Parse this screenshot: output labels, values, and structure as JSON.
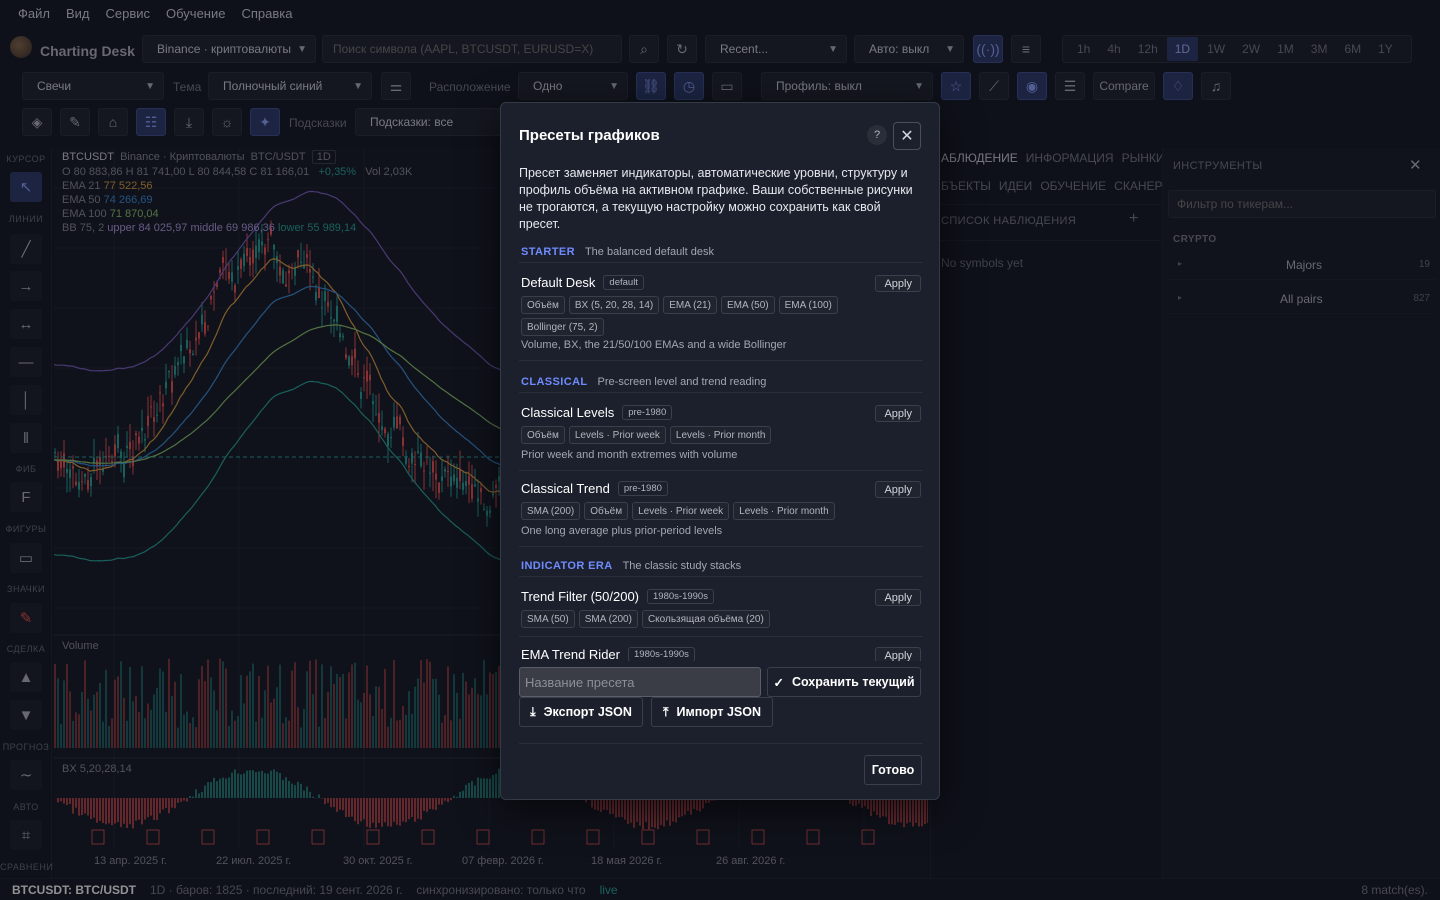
{
  "menu": [
    "Файл",
    "Вид",
    "Сервис",
    "Обучение",
    "Справка"
  ],
  "toolbar1": {
    "app_name": "Charting Desk",
    "exchange": "Binance · криптовалюты",
    "search_placeholder": "Поиск символа (AAPL, BTCUSDT, EURUSD=X)",
    "recent": "Recent...",
    "auto": "Авто: выкл",
    "timeframes": [
      "1h",
      "4h",
      "12h",
      "1D",
      "1W",
      "2W",
      "1M",
      "3M",
      "6M",
      "1Y"
    ],
    "active_timeframe": "1D"
  },
  "toolbar2": {
    "chart_type": "Свечи",
    "theme_label": "Тема",
    "theme": "Полночный синий",
    "layout_label": "Расположение",
    "layout": "Одно",
    "profile": "Профиль: выкл",
    "compare": "Compare"
  },
  "toolbar3": {
    "hints_label": "Подсказки",
    "hints": "Подсказки: все"
  },
  "leftbar": {
    "cursor": "КУРСОР",
    "lines": "ЛИНИИ",
    "fib": "ФИБ",
    "fib_btn": "F",
    "shapes": "ФИГУРЫ",
    "icons": "ЗНАЧКИ",
    "trade": "СДЕЛКА",
    "forecast": "ПРОГНОЗ",
    "auto": "АВТО",
    "compare": "СРАВНЕНИЕ"
  },
  "chart": {
    "symbol": "BTCUSDT",
    "exchange": "Binance · Криптовалюты",
    "pair": "BTC/USDT",
    "tf": "1D",
    "ohlc": "O 80 883,86   H 81 741,00   L 80 844,58   C 81 166,01",
    "change": "+0,35%",
    "vol": "Vol 2,03K",
    "ema21_label": "EMA 21",
    "ema21": "77 522,56",
    "ema50_label": "EMA 50",
    "ema50": "74 266,69",
    "ema100_label": "EMA 100",
    "ema100": "71 870,04",
    "bb_label": "BB 75, 2",
    "bb_upper": "upper 84 025,97",
    "bb_middle": "middle 69 986,36",
    "bb_lower": "lower 55 989,14",
    "volume_label": "Volume",
    "bx_label": "BX 5,20,28,14",
    "dates": [
      "13 апр. 2025 г.",
      "22 июл. 2025 г.",
      "30 окт. 2025 г.",
      "07 февр. 2026 г.",
      "18 мая 2026 г.",
      "26 авг. 2026 г."
    ],
    "colors": {
      "ema21": "#e0a040",
      "ema50": "#3a8fd9",
      "ema100": "#8ec96a",
      "bb_band": "#7b5fc4",
      "bb_lower": "#26a69a",
      "up": "#26a69a",
      "down": "#ef5350"
    }
  },
  "watch": {
    "tabs_row1": [
      "АБЛЮДЕНИЕ",
      "ИНФОРМАЦИЯ",
      "РЫНКИ"
    ],
    "tabs_row2": [
      "БЪЕКТЫ",
      "ИДЕИ",
      "ОБУЧЕНИЕ",
      "СКАНЕР"
    ],
    "list_title": "СПИСОК НАБЛЮДЕНИЯ",
    "empty": "No symbols yet"
  },
  "instruments": {
    "title": "ИНСТРУМЕНТЫ",
    "filter_placeholder": "Фильтр по тикерам...",
    "group": "CRYPTO",
    "rows": [
      {
        "name": "Majors",
        "count": "19"
      },
      {
        "name": "All pairs",
        "count": "827"
      }
    ]
  },
  "status": {
    "symbol": "BTCUSDT: BTC/USDT",
    "info": "1D · баров: 1825 · последний: 19 сент. 2026 г.",
    "sync": "синхронизировано: только что",
    "live": "live",
    "matches": "8 match(es)."
  },
  "modal": {
    "title": "Пресеты графиков",
    "help": "?",
    "description": "Пресет заменяет индикаторы, автоматические уровни, структуру и профиль объёма на активном графике. Ваши собственные рисунки не трогаются, а текущую настройку можно сохранить как свой пресет.",
    "apply_label": "Apply",
    "groups": [
      {
        "key": "STARTER",
        "sub": "The balanced default desk"
      },
      {
        "key": "CLASSICAL",
        "sub": "Pre-screen level and trend reading"
      },
      {
        "key": "INDICATOR ERA",
        "sub": "The classic study stacks"
      }
    ],
    "presets": [
      {
        "name": "Default Desk",
        "era": "default",
        "chips": [
          "Объём",
          "BX (5, 20, 28, 14)",
          "EMA (21)",
          "EMA (50)",
          "EMA (100)",
          "Bollinger (75, 2)"
        ],
        "desc": "Volume, BX, the 21/50/100 EMAs and a wide Bollinger"
      },
      {
        "name": "Classical Levels",
        "era": "pre-1980",
        "chips": [
          "Объём",
          "Levels · Prior week",
          "Levels · Prior month"
        ],
        "desc": "Prior week and month extremes with volume"
      },
      {
        "name": "Classical Trend",
        "era": "pre-1980",
        "chips": [
          "SMA (200)",
          "Объём",
          "Levels · Prior week",
          "Levels · Prior month"
        ],
        "desc": "One long average plus prior-period levels"
      },
      {
        "name": "Trend Filter (50/200)",
        "era": "1980s-1990s",
        "chips": [
          "SMA (50)",
          "SMA (200)",
          "Скользящая объёма (20)"
        ],
        "desc": ""
      },
      {
        "name": "EMA Trend Rider",
        "era": "1980s-1990s",
        "chips": [],
        "desc": ""
      }
    ],
    "name_placeholder": "Название пресета",
    "save_current": "Сохранить текущий",
    "export_json": "Экспорт JSON",
    "import_json": "Импорт JSON",
    "done": "Готово"
  }
}
